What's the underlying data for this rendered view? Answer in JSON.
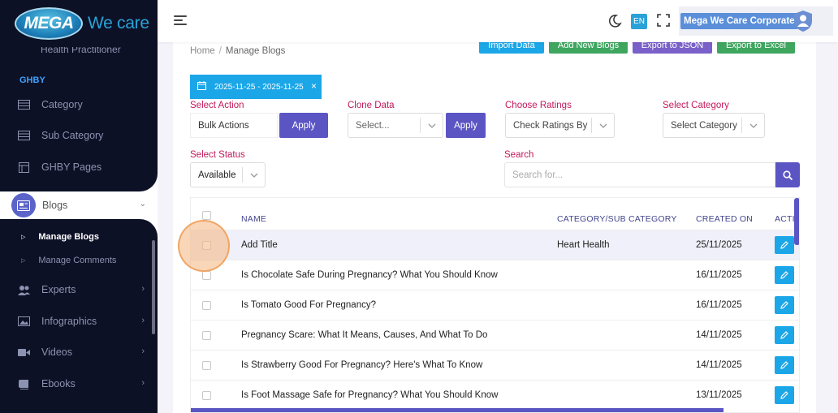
{
  "brand": {
    "logo_mark": "MEGA",
    "logo_text": "We care"
  },
  "sidebar": {
    "cut_item": "Health Practitioner",
    "section": "GHBY",
    "items_top": [
      {
        "label": "Category",
        "icon": "table-icon"
      },
      {
        "label": "Sub Category",
        "icon": "table-icon"
      },
      {
        "label": "GHBY Pages",
        "icon": "layout-icon"
      }
    ],
    "blogs": {
      "label": "Blogs",
      "icon": "newspaper-icon"
    },
    "sub_items": [
      {
        "label": "Manage Blogs",
        "active": true
      },
      {
        "label": "Manage Comments",
        "active": false
      }
    ],
    "items_bottom": [
      {
        "label": "Experts",
        "icon": "users-icon"
      },
      {
        "label": "Infographics",
        "icon": "image-icon"
      },
      {
        "label": "Videos",
        "icon": "video-icon"
      },
      {
        "label": "Ebooks",
        "icon": "book-icon"
      }
    ]
  },
  "topbar": {
    "lang": "EN",
    "profile_name": "Mega We Care Corporate",
    "icons": [
      "menu-icon",
      "moon-icon",
      "fullscreen-icon",
      "avatar-icon"
    ]
  },
  "breadcrumb": {
    "home": "Home",
    "separator": "/",
    "current": "Manage Blogs"
  },
  "top_buttons": {
    "import": "Import Data",
    "add": "Add New Blogs",
    "export_json": "Export to JSON",
    "export_excel": "Export to Excel"
  },
  "filters": {
    "date_range": "2025-11-25 - 2025-11-25",
    "date_clear": "×",
    "select_action": {
      "label": "Select Action",
      "value": "Bulk Actions",
      "apply": "Apply"
    },
    "clone_data": {
      "label": "Clone Data",
      "value": "Select...",
      "apply": "Apply"
    },
    "ratings": {
      "label": "Choose Ratings",
      "value": "Check Ratings By"
    },
    "category": {
      "label": "Select Category",
      "value": "Select Category"
    },
    "status": {
      "label": "Select Status",
      "value": "Available"
    },
    "search": {
      "label": "Search",
      "placeholder": "Search for..."
    }
  },
  "table": {
    "headers": {
      "name": "NAME",
      "category": "CATEGORY/SUB CATEGORY",
      "created": "CREATED ON",
      "action": "ACTI"
    },
    "rows": [
      {
        "name": "Add Title",
        "category": "Heart Health",
        "created": "25/11/2025"
      },
      {
        "name": "Is Chocolate Safe During Pregnancy? What You Should Know",
        "category": "",
        "created": "16/11/2025"
      },
      {
        "name": "Is Tomato Good For Pregnancy?",
        "category": "",
        "created": "16/11/2025"
      },
      {
        "name": "Pregnancy Scare: What It Means, Causes, And What To Do",
        "category": "",
        "created": "14/11/2025"
      },
      {
        "name": "Is Strawberry Good For Pregnancy? Here's What To Know",
        "category": "",
        "created": "14/11/2025"
      },
      {
        "name": "Is Foot Massage Safe for Pregnancy? What You Should Know",
        "category": "",
        "created": "13/11/2025"
      }
    ]
  },
  "colors": {
    "sidebar_bg": "#0d1126",
    "accent": "#5b55c4",
    "info": "#1ba6e8",
    "label_pink": "#c2185b",
    "header_text": "#43468b"
  }
}
